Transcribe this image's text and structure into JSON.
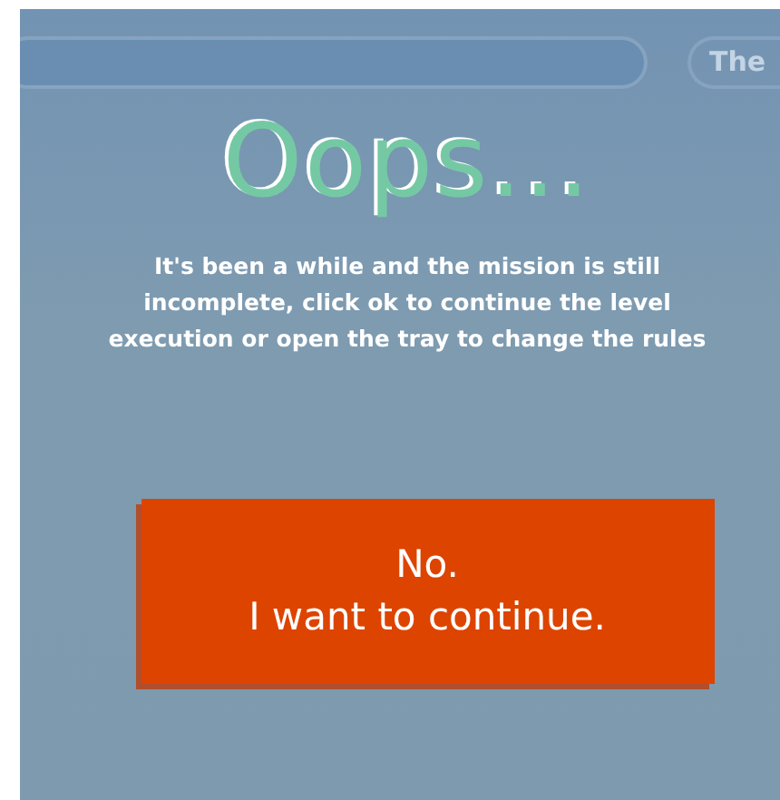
{
  "background_bar": {
    "pill": {
      "label": "The"
    }
  },
  "dialog": {
    "title": "Oops...",
    "message": "It's been a while and the mission is still incomplete, click ok to continue the level execution or open the tray to change the rules",
    "buttons": [
      {
        "kind": "primary",
        "lines": [
          "No.",
          "I want to continue."
        ]
      }
    ]
  }
}
